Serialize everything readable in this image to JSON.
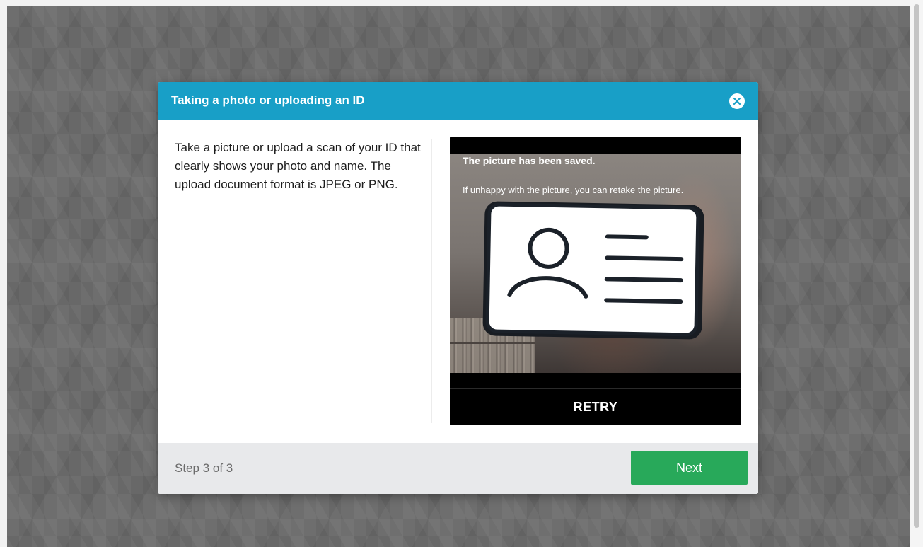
{
  "modal": {
    "title": "Taking a photo or uploading an ID",
    "instructions": "Take a picture or upload a scan of your ID that clearly shows your photo and name. The upload document format is JPEG or PNG.",
    "close_icon": "close-icon"
  },
  "camera": {
    "saved_title": "The picture has been saved.",
    "saved_subtitle": "If unhappy with the picture, you can retake the picture.",
    "retry_label": "RETRY",
    "card_icon": "id-card-icon"
  },
  "footer": {
    "step_text": "Step 3 of 3",
    "next_label": "Next"
  },
  "colors": {
    "header": "#189fc7",
    "next_button": "#28a95a",
    "backdrop": "#6e6e6e"
  }
}
